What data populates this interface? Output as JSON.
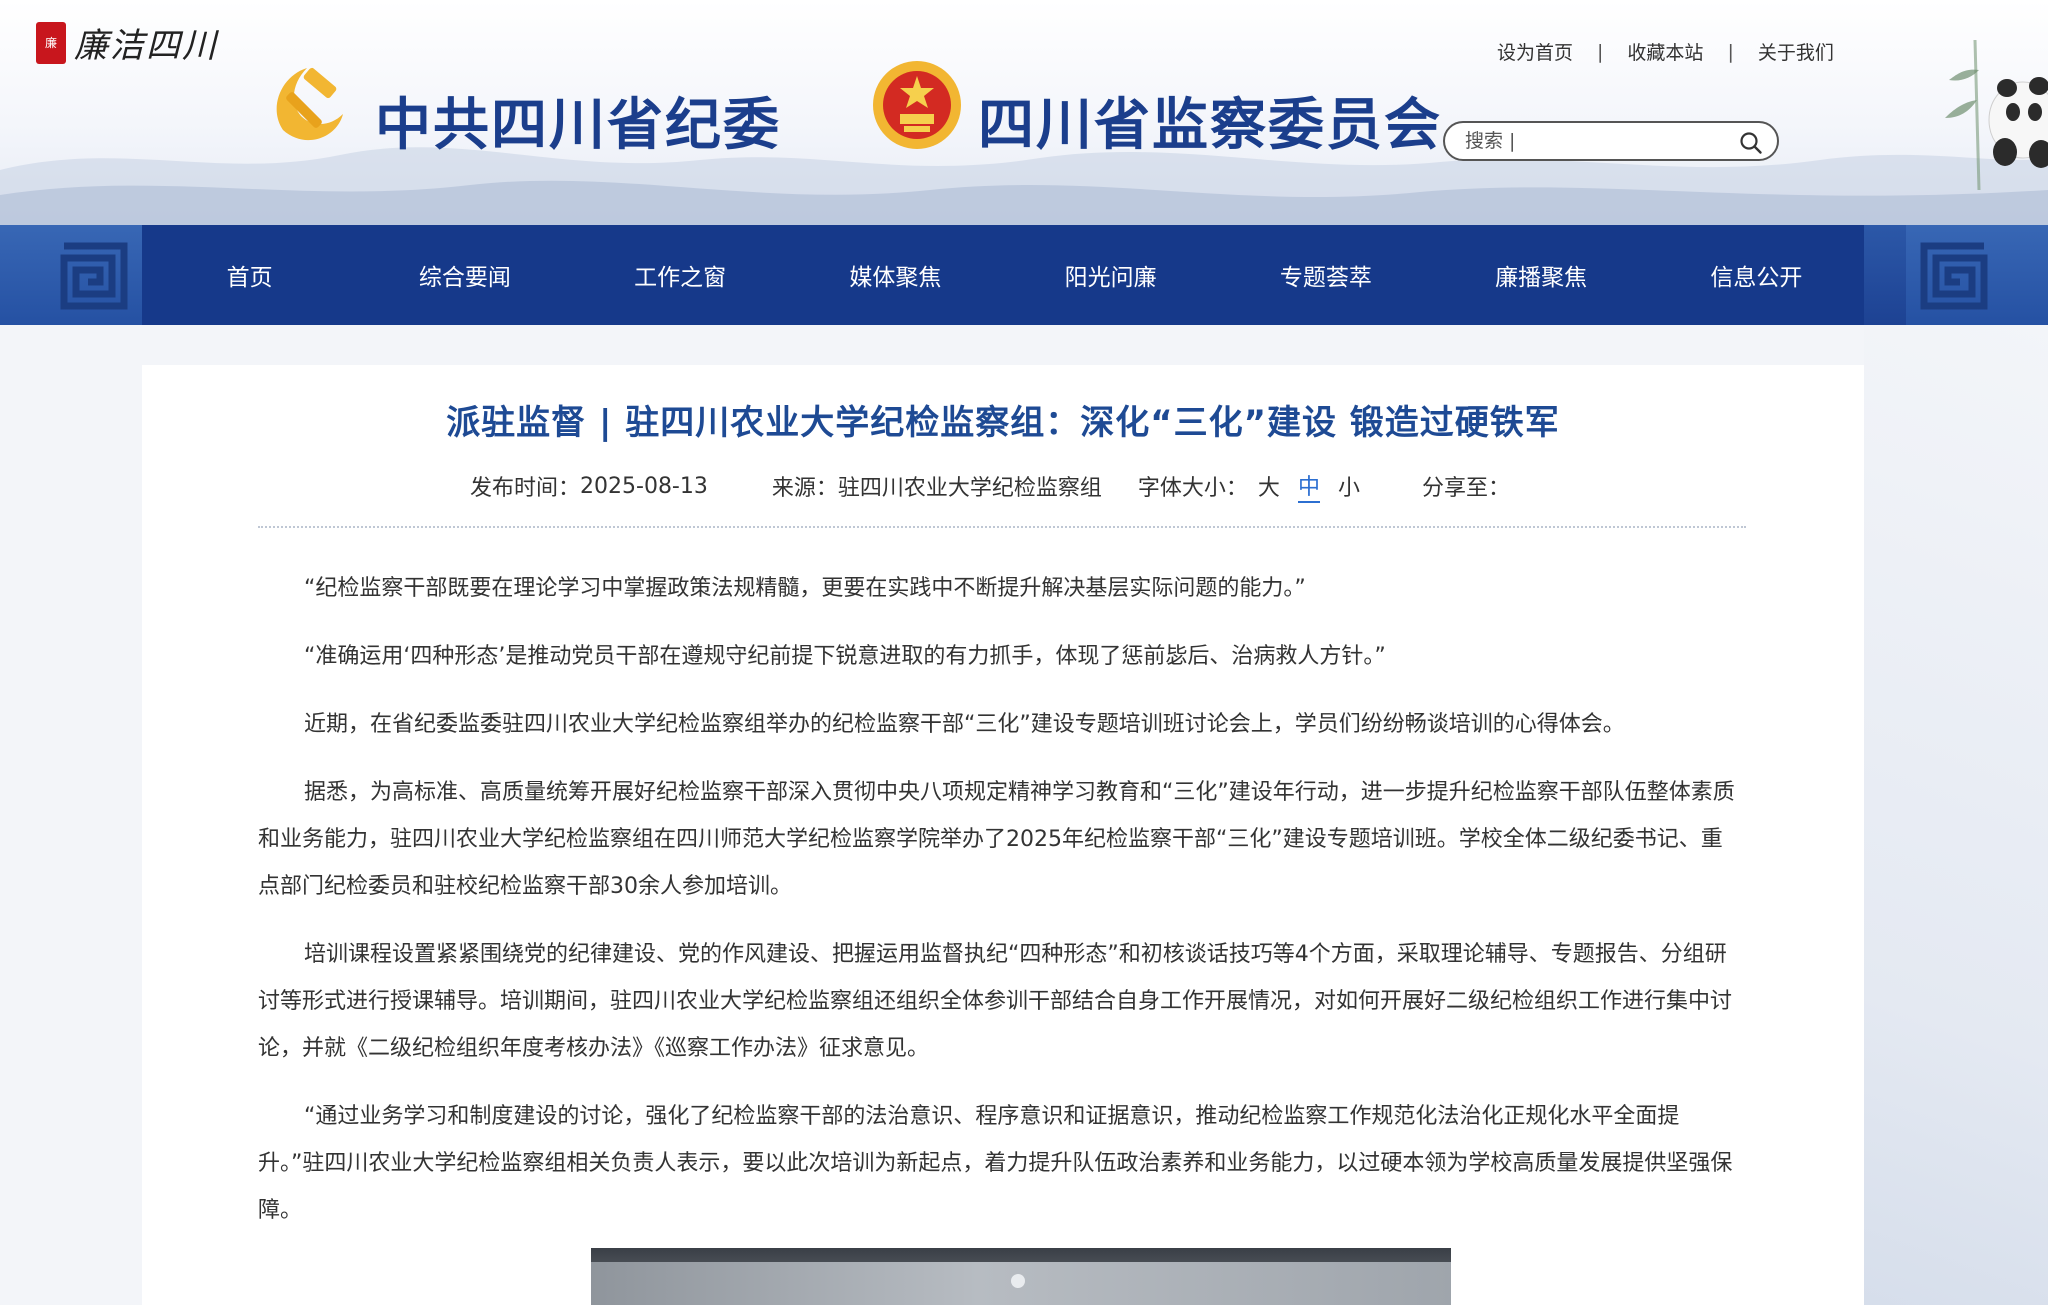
{
  "header": {
    "brand_seal_text": "廉",
    "brand_name": "廉洁四川",
    "party_title": "中共四川省纪委",
    "commission_title": "四川省监察委员会",
    "links": [
      "设为首页",
      "收藏本站",
      "关于我们"
    ],
    "separator": "|",
    "search_placeholder": "搜索 |"
  },
  "nav": {
    "items": [
      "首页",
      "综合要闻",
      "工作之窗",
      "媒体聚焦",
      "阳光问廉",
      "专题荟萃",
      "廉播聚焦",
      "信息公开"
    ]
  },
  "article": {
    "title": "派驻监督 | 驻四川农业大学纪检监察组：深化“三化”建设 锻造过硬铁军",
    "date_label": "发布时间：",
    "date": "2025-08-13",
    "source_label": "来源：",
    "source": "驻四川农业大学纪检监察组",
    "font_size_label": "字体大小：",
    "font_sizes": [
      "大",
      "中",
      "小"
    ],
    "font_size_active": "中",
    "share_label": "分享至：",
    "paragraphs": [
      "“纪检监察干部既要在理论学习中掌握政策法规精髓，更要在实践中不断提升解决基层实际问题的能力。”",
      "“准确运用‘四种形态’是推动党员干部在遵规守纪前提下锐意进取的有力抓手，体现了惩前毖后、治病救人方针。”",
      "近期，在省纪委监委驻四川农业大学纪检监察组举办的纪检监察干部“三化”建设专题培训班讨论会上，学员们纷纷畅谈培训的心得体会。",
      "据悉，为高标准、高质量统筹开展好纪检监察干部深入贯彻中央八项规定精神学习教育和“三化”建设年行动，进一步提升纪检监察干部队伍整体素质和业务能力，驻四川农业大学纪检监察组在四川师范大学纪检监察学院举办了2025年纪检监察干部“三化”建设专题培训班。学校全体二级纪委书记、重点部门纪检委员和驻校纪检监察干部30余人参加培训。",
      "培训课程设置紧紧围绕党的纪律建设、党的作风建设、把握运用监督执纪“四种形态”和初核谈话技巧等4个方面，采取理论辅导、专题报告、分组研讨等形式进行授课辅导。培训期间，驻四川农业大学纪检监察组还组织全体参训干部结合自身工作开展情况，对如何开展好二级纪检组织工作进行集中讨论，并就《二级纪检组织年度考核办法》《巡察工作办法》征求意见。",
      "“通过业务学习和制度建设的讨论，强化了纪检监察干部的法治意识、程序意识和证据意识，推动纪检监察工作规范化法治化正规化水平全面提升。”驻四川农业大学纪检监察组相关负责人表示，要以此次培训为新起点，着力提升队伍政治素养和业务能力，以过硬本领为学校高质量发展提供坚强保障。"
    ]
  },
  "colors": {
    "nav_bg": "#16398a",
    "title_blue": "#1e4a94",
    "header_title_blue": "#1b3e8c",
    "active_font_size": "#2c6fd1",
    "party_red": "#c8161d",
    "party_gold": "#f2b632"
  },
  "icons": {
    "search": "search-icon",
    "party_emblem": "hammer-sickle-icon",
    "national_emblem": "national-emblem-icon"
  }
}
